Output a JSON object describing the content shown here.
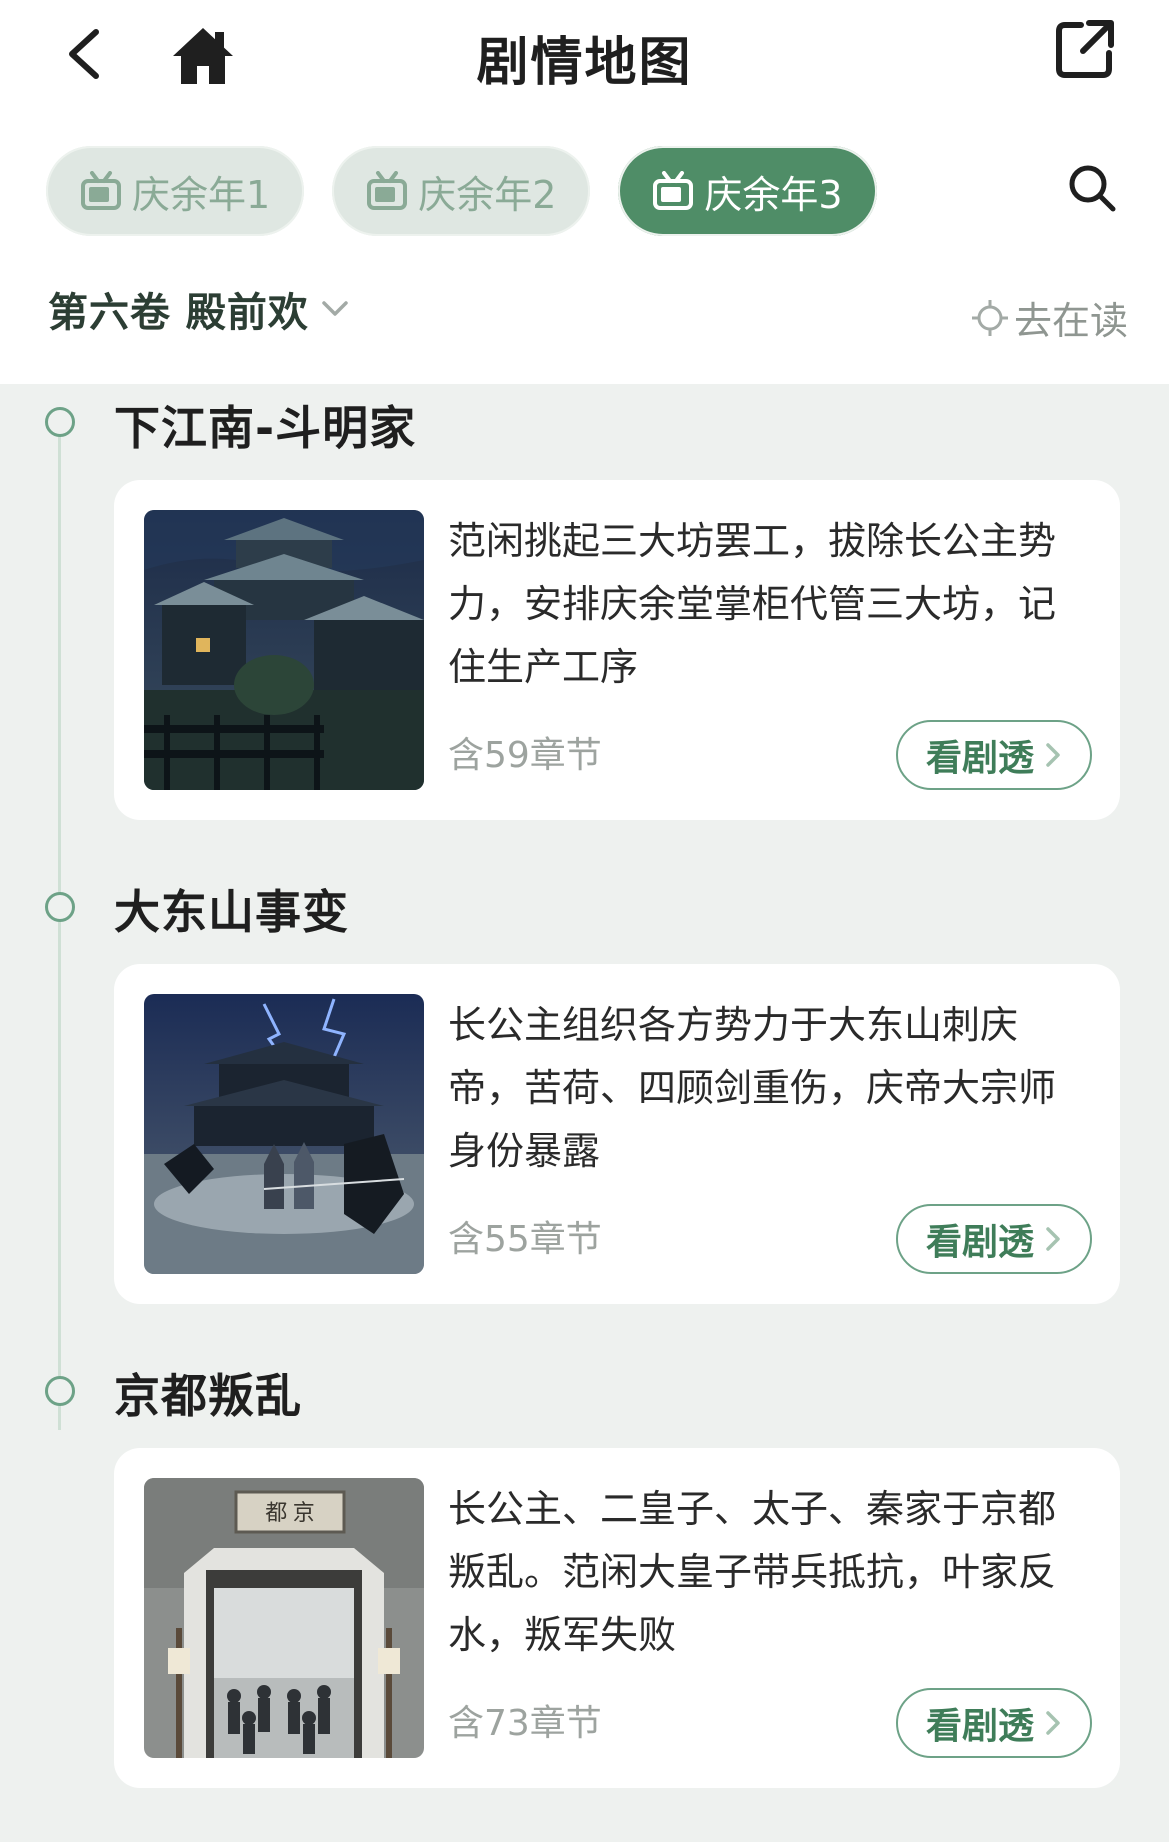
{
  "header": {
    "title": "剧情地图",
    "back_icon": "chevron-left-icon",
    "home_icon": "home-icon",
    "share_icon": "share-external-icon"
  },
  "tabs": [
    {
      "label": "庆余年1",
      "active": false,
      "icon": "tv-icon"
    },
    {
      "label": "庆余年2",
      "active": false,
      "icon": "tv-icon"
    },
    {
      "label": "庆余年3",
      "active": true,
      "icon": "tv-icon"
    }
  ],
  "search": {
    "icon": "search-icon"
  },
  "volume": {
    "label": "第六卷 殿前欢",
    "icon": "chevron-down-icon"
  },
  "goto_reading": {
    "label": "去在读",
    "icon": "crosshair-icon"
  },
  "colors": {
    "accent": "#4f8d67",
    "accent_light": "#dfe7e2",
    "timeline_bg": "#eef1ef"
  },
  "sections": [
    {
      "title": "下江南-斗明家",
      "description": "范闲挑起三大坊罢工，拔除长公主势力，安排庆余堂掌柜代管三大坊，记住生产工序",
      "chapters": "含59章节",
      "button": "看剧透"
    },
    {
      "title": "大东山事变",
      "description": "长公主组织各方势力于大东山刺庆帝，苦荷、四顾剑重伤，庆帝大宗师身份暴露",
      "chapters": "含55章节",
      "button": "看剧透"
    },
    {
      "title": "京都叛乱",
      "description": "长公主、二皇子、太子、秦家于京都叛乱。范闲大皇子带兵抵抗，叶家反水，叛军失败",
      "chapters": "含73章节",
      "button": "看剧透",
      "gate_sign": "都 京"
    }
  ]
}
